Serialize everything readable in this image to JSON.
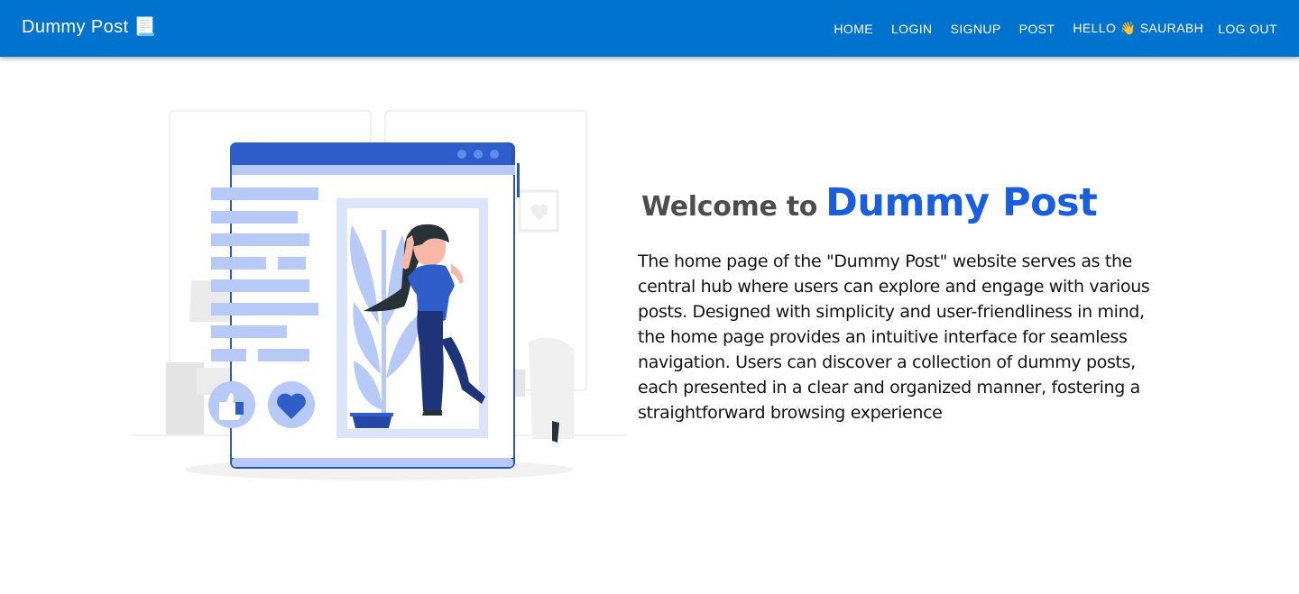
{
  "navbar": {
    "brand": "Dummy Post 📃",
    "links": [
      "Home",
      "Login",
      "Signup",
      "Post",
      "Hello 👋 Saurabh",
      "Log out"
    ]
  },
  "hero": {
    "welcome_prefix": "Welcome to",
    "welcome_brand": "Dummy Post",
    "description": "The home page of the \"Dummy Post\" website serves as the central hub where users can explore and engage with various posts. Designed with simplicity and user-friendliness in mind, the home page provides an intuitive interface for seamless navigation. Users can discover a collection of dummy posts, each presented in a clear and organized manner, fostering a straightforward browsing experience"
  },
  "colors": {
    "navbar": "#0073cf",
    "brand_accent": "#1a5ee0",
    "illustration_primary": "#2f5ecb",
    "illustration_light": "#b6c9f7"
  }
}
